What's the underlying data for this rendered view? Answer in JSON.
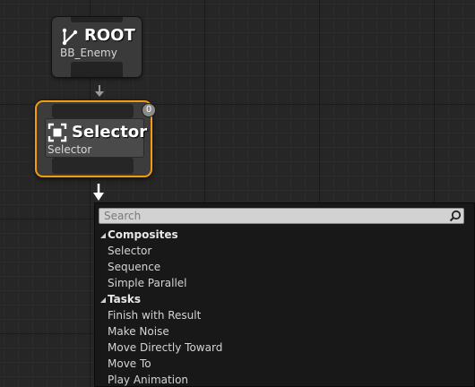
{
  "root_node": {
    "title": "ROOT",
    "subtitle": "BB_Enemy",
    "icon": "branch-icon"
  },
  "selector_node": {
    "title": "Selector",
    "subtitle": "Selector",
    "icon": "selector-icon",
    "execution_index": "0",
    "border_color": "#f39c12"
  },
  "menu": {
    "search_placeholder": "Search",
    "categories": [
      {
        "label": "Composites",
        "items": [
          "Selector",
          "Sequence",
          "Simple Parallel"
        ]
      },
      {
        "label": "Tasks",
        "items": [
          "Finish with Result",
          "Make Noise",
          "Move Directly Toward",
          "Move To",
          "Play Animation"
        ]
      }
    ]
  }
}
